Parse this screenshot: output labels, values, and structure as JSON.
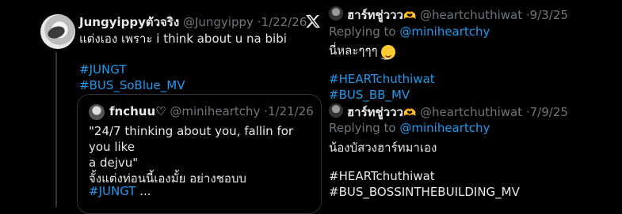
{
  "left_tweet": {
    "display_name": "Jungyippyตัวจริง",
    "handle": "@Jungyippy",
    "date": "1/22/26",
    "text": "แต่งเอง เพราะ i think about u na bibi",
    "hashtags": [
      "#JUNGT",
      "#BUS_SoBlue_MV"
    ],
    "quote": {
      "display_name": "fnchuu♡",
      "handle": "@miniheartchy",
      "date": "1/21/26",
      "line1": "\"24/7 thinking about you, fallin for you like",
      "line2": "a dejvu\"",
      "line3": "จั้งแต่งท่อนนี้เองมั้ย อย่างชอบบ",
      "hashtag": "#JUNGT",
      "ellipsis": " ..."
    }
  },
  "right_tweets": [
    {
      "display_name": "ฮาร์ทชู่ววว",
      "handle": "@heartchuthiwat",
      "date": "9/3/25",
      "replying_prefix": "Replying to",
      "replying_to": "@miniheartchy",
      "text": "นี่หละๆๆๆ",
      "emoji": "face-savoring-emoji",
      "hashtags": [
        "#HEARTchuthiwat",
        "#BUS_BB_MV"
      ]
    },
    {
      "display_name": "ฮาร์ทชู่ววว",
      "handle": "@heartchuthiwat",
      "date": "7/9/25",
      "replying_prefix": "Replying to",
      "replying_to": "@miniheartchy",
      "text": "น้องบัสวงฮาร์ทมาเอง",
      "hashtags": [
        "#HEARTchuthiwat",
        "#BUS_BOSSINTHEBUILDING_MV"
      ]
    }
  ],
  "separator": "·",
  "colors": {
    "background": "#000000",
    "text": "#e7e9ea",
    "muted": "#71767b",
    "link": "#1d9bf0"
  }
}
